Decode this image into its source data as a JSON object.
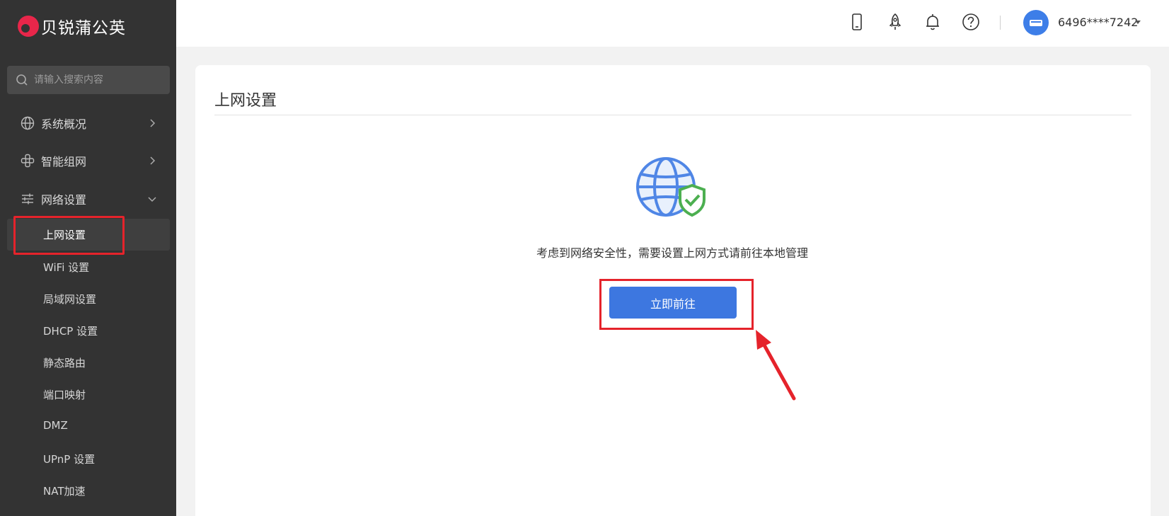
{
  "brand": {
    "name": "贝锐蒲公英",
    "logo_color": "#e8264a"
  },
  "search": {
    "placeholder": "请输入搜索内容"
  },
  "sidebar": {
    "items": [
      {
        "label": "系统概况",
        "icon": "globe-icon",
        "expanded": false
      },
      {
        "label": "智能组网",
        "icon": "network-icon",
        "expanded": false
      },
      {
        "label": "网络设置",
        "icon": "sliders-icon",
        "expanded": true
      }
    ],
    "subitems": [
      {
        "label": "上网设置",
        "active": true
      },
      {
        "label": "WiFi 设置"
      },
      {
        "label": "局域网设置"
      },
      {
        "label": "DHCP 设置"
      },
      {
        "label": "静态路由"
      },
      {
        "label": "端口映射"
      },
      {
        "label": "DMZ"
      },
      {
        "label": "UPnP 设置"
      },
      {
        "label": "NAT加速"
      }
    ]
  },
  "header": {
    "icons": [
      "mobile-icon",
      "rocket-icon",
      "bell-icon",
      "help-icon"
    ],
    "user": "6496****7242"
  },
  "main": {
    "title": "上网设置",
    "message": "考虑到网络安全性，需要设置上网方式请前往本地管理",
    "button_label": "立即前往"
  },
  "colors": {
    "primary": "#3d77e0",
    "highlight": "#e5232b",
    "sidebar": "#333333",
    "shield": "#4caf50"
  }
}
